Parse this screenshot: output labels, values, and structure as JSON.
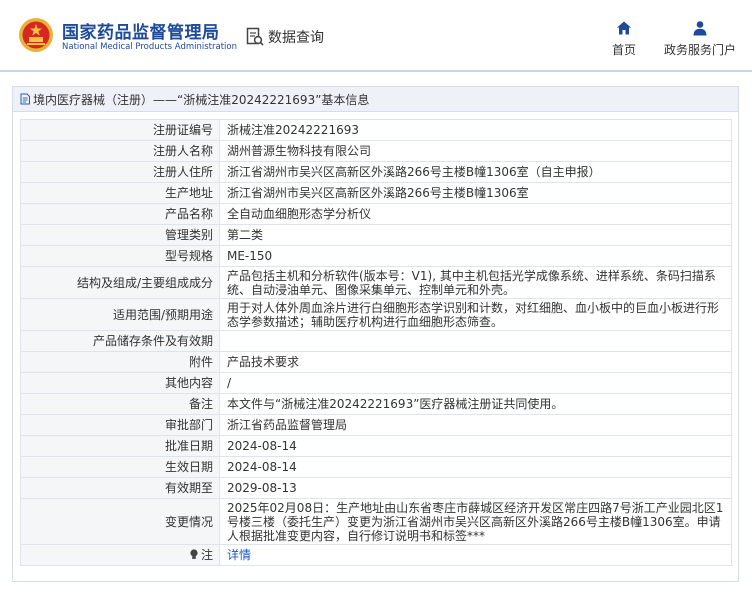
{
  "header": {
    "brand_cn": "国家药品监督管理局",
    "brand_en": "National Medical Products Administration",
    "query_label": "数据查询",
    "nav": {
      "home": "首页",
      "portal": "政务服务门户"
    }
  },
  "colors": {
    "brand": "#1f4a9a",
    "link": "#1a5bb5",
    "label_bg": "#f5f6f8",
    "titlebar_bg": "#eef2f8"
  },
  "icons": {
    "emblem": "national-emblem-icon",
    "query": "data-query-icon",
    "home": "home-icon",
    "portal": "user-icon",
    "title": "document-icon",
    "note": "lightbulb-icon"
  },
  "page": {
    "title": "境内医疗器械（注册）——“浙械注准20242221693”基本信息"
  },
  "record": {
    "rows": [
      {
        "label": "注册证编号",
        "value": "浙械注准20242221693"
      },
      {
        "label": "注册人名称",
        "value": "湖州普源生物科技有限公司"
      },
      {
        "label": "注册人住所",
        "value": "浙江省湖州市吴兴区高新区外溪路266号主楼B幢1306室（自主申报）"
      },
      {
        "label": "生产地址",
        "value": "浙江省湖州市吴兴区高新区外溪路266号主楼B幢1306室"
      },
      {
        "label": "产品名称",
        "value": "全自动血细胞形态学分析仪"
      },
      {
        "label": "管理类别",
        "value": "第二类"
      },
      {
        "label": "型号规格",
        "value": "ME-150"
      },
      {
        "label": "结构及组成/主要组成成分",
        "value": "产品包括主机和分析软件(版本号：V1), 其中主机包括光学成像系统、进样系统、条码扫描系统、自动浸油单元、图像采集单元、控制单元和外壳。"
      },
      {
        "label": "适用范围/预期用途",
        "value": "用于对人体外周血涂片进行白细胞形态学识别和计数，对红细胞、血小板中的巨血小板进行形态学参数描述；辅助医疗机构进行血细胞形态筛查。"
      },
      {
        "label": "产品储存条件及有效期",
        "value": ""
      },
      {
        "label": "附件",
        "value": "产品技术要求"
      },
      {
        "label": "其他内容",
        "value": "/"
      },
      {
        "label": "备注",
        "value": "本文件与“浙械注准20242221693”医疗器械注册证共同使用。"
      },
      {
        "label": "审批部门",
        "value": "浙江省药品监督管理局"
      },
      {
        "label": "批准日期",
        "value": "2024-08-14"
      },
      {
        "label": "生效日期",
        "value": "2024-08-14"
      },
      {
        "label": "有效期至",
        "value": "2029-08-13"
      },
      {
        "label": "变更情况",
        "value": "2025年02月08日：生产地址由山东省枣庄市薛城区经济开发区常庄四路7号浙工产业园北区1号楼三楼（委托生产）变更为浙江省湖州市吴兴区高新区外溪路266号主楼B幢1306室。申请人根据批准变更内容，自行修订说明书和标签***"
      },
      {
        "label": "注",
        "value": "详情"
      }
    ]
  }
}
